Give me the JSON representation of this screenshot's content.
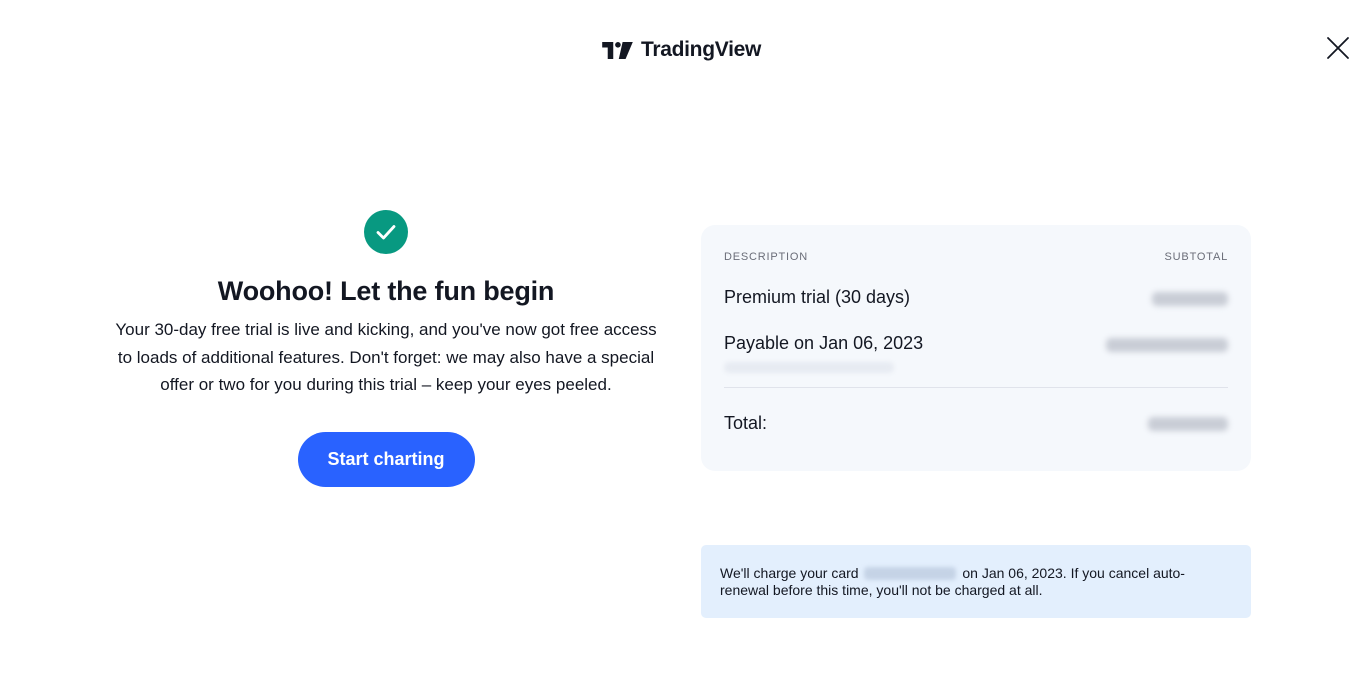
{
  "header": {
    "brand_name": "TradingView",
    "logo_icon": "tradingview-logo-icon",
    "close_icon": "close-icon"
  },
  "success": {
    "icon": "check-icon",
    "icon_color": "#089981",
    "headline": "Woohoo! Let the fun begin",
    "body": "Your 30-day free trial is live and kicking, and you've now got free access to loads of additional features. Don't forget: we may also have a special offer or two for you during this trial – keep your eyes peeled.",
    "cta_label": "Start charting",
    "cta_color": "#2962ff"
  },
  "summary": {
    "col_description": "DESCRIPTION",
    "col_subtotal": "SUBTOTAL",
    "trial_label": "Premium trial (30 days)",
    "payable_label": "Payable on Jan 06, 2023",
    "total_label": "Total:"
  },
  "notice": {
    "prefix": "We'll charge your card",
    "suffix": "on Jan 06, 2023. If you cancel auto-renewal before this time, you'll not be charged at all."
  }
}
